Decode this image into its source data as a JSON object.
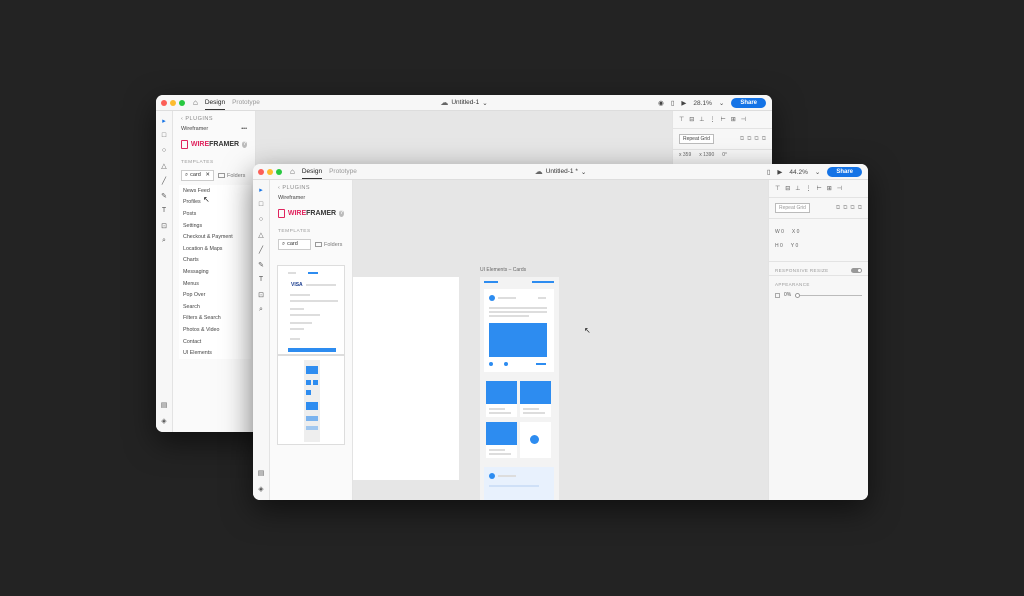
{
  "back_window": {
    "tabs": [
      "Design",
      "Prototype"
    ],
    "doc_title": "Untitled-1",
    "zoom": "28.1%",
    "share_label": "Share",
    "plugins_back": "PLUGINS",
    "plugin_name": "Wireframer",
    "logo_wire": "WIRE",
    "logo_framer": "FRAMER",
    "templates_label": "TEMPLATES",
    "search_value": "card",
    "folders_label": "Folders",
    "list_items": [
      "News Feed",
      "Profiles",
      "Posts",
      "Settings",
      "Checkout & Payment",
      "Location & Maps",
      "Charts",
      "Messaging",
      "Menus",
      "Pop Over",
      "Search",
      "Filters & Search",
      "Photos & Video",
      "Contact",
      "UI Elements"
    ],
    "repeat_grid": "Repeat Grid",
    "coords": [
      "x 359",
      "x 1390",
      "0°"
    ]
  },
  "front_window": {
    "tabs": [
      "Design",
      "Prototype"
    ],
    "doc_title": "Untitled-1 *",
    "zoom": "44.2%",
    "share_label": "Share",
    "plugins_back": "PLUGINS",
    "plugin_name": "Wireframer",
    "logo_wire": "WIRE",
    "logo_framer": "FRAMER",
    "templates_label": "TEMPLATES",
    "search_value": "card",
    "folders_label": "Folders",
    "artboard_label": "UI Elements – Cards",
    "repeat_grid": "Repeat Grid",
    "w_label": "W",
    "h_label": "H",
    "w_value": "0",
    "h_value": "0",
    "x_label": "X",
    "y_label": "Y",
    "x_value": "0",
    "y_value": "0",
    "responsive_resize": "RESPONSIVE RESIZE",
    "appearance": "APPEARANCE",
    "opacity": "0%"
  },
  "icons": {
    "select": "▸",
    "rect": "□",
    "ellipse": "○",
    "triangle": "△",
    "line": "╱",
    "pen": "✎",
    "text": "T",
    "artboard": "⊡",
    "zoom": "⌕",
    "layers": "◈",
    "assets": "▤",
    "home": "⌂",
    "cloud": "☁",
    "play": "▶",
    "phone": "▯",
    "user": "◉"
  }
}
